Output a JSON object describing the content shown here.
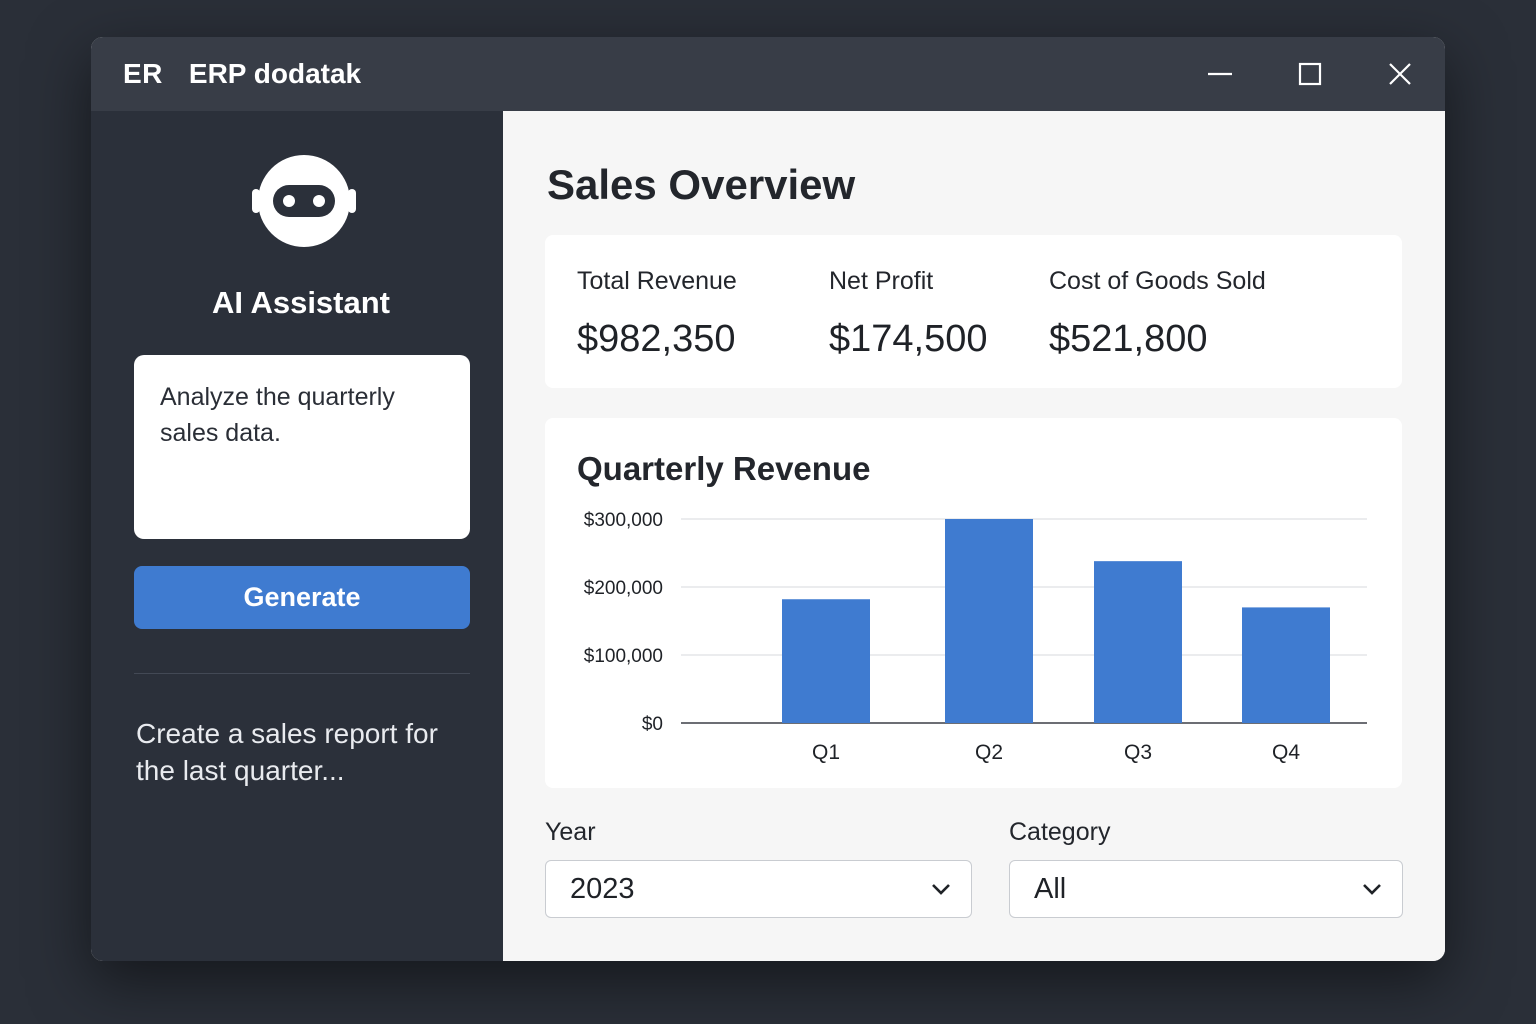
{
  "window": {
    "logo": "ER",
    "title": "ERP dodatak"
  },
  "sidebar": {
    "assistant_title": "AI Assistant",
    "prompt_value": "Analyze the quarterly sales data.",
    "generate_label": "Generate",
    "suggestion": "Create a sales report for the last quarter..."
  },
  "main": {
    "title": "Sales Overview",
    "kpis": [
      {
        "label": "Total Revenue",
        "value": "$982,350"
      },
      {
        "label": "Net Profit",
        "value": "$174,500"
      },
      {
        "label": "Cost of Goods Sold",
        "value": "$521,800"
      }
    ],
    "filters": {
      "year_label": "Year",
      "year_value": "2023",
      "category_label": "Category",
      "category_value": "All"
    }
  },
  "colors": {
    "accent": "#3f7bd0",
    "titlebar": "#383d47",
    "sidebar": "#2b303a"
  },
  "chart_data": {
    "type": "bar",
    "title": "Quarterly Revenue",
    "categories": [
      "Q1",
      "Q2",
      "Q3",
      "Q4"
    ],
    "values": [
      182000,
      300000,
      238000,
      170000
    ],
    "ylim": [
      0,
      300000
    ],
    "yticks": [
      0,
      100000,
      200000,
      300000
    ],
    "ytick_labels": [
      "$0",
      "$100,000",
      "$200,000",
      "$300,000"
    ],
    "grid": true,
    "color": "#3f7bd0"
  }
}
